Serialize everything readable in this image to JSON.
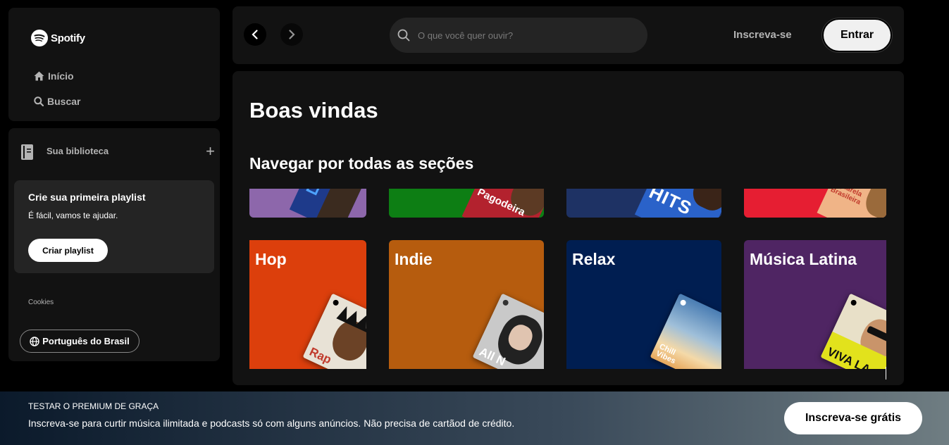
{
  "brand": {
    "name": "Spotify"
  },
  "nav": {
    "home_label": "Início",
    "search_label": "Buscar"
  },
  "library": {
    "title": "Sua biblioteca",
    "promo": {
      "title": "Crie sua primeira playlist",
      "subtitle": "É fácil, vamos te ajudar.",
      "button": "Criar playlist"
    },
    "cookies": "Cookies",
    "language": "Português do Brasil"
  },
  "topbar": {
    "search_placeholder": "O que você quer ouvir?",
    "signup": "Inscreva-se",
    "login": "Entrar"
  },
  "main": {
    "title": "Boas vindas",
    "section_title": "Navegar por todas as seções",
    "top_row": [
      {
        "color": "#8d67ab",
        "art_text": ""
      },
      {
        "color": "#0d7e14",
        "art_text": "Pagodeira"
      },
      {
        "color": "#1e3264",
        "art_text": "HITS"
      },
      {
        "color": "#e61e32",
        "art_text": "Aquarela Brasileira"
      }
    ],
    "categories": [
      {
        "label": "Hop",
        "color": "#dc3f0c",
        "art_text": "Rap",
        "icon": "album-cover-icon"
      },
      {
        "label": "Indie",
        "color": "#b65c0e",
        "art_text": "All N",
        "icon": "album-cover-icon"
      },
      {
        "label": "Relax",
        "color": "#001e51",
        "art_text": "Chill Vibes",
        "icon": "album-cover-icon"
      },
      {
        "label": "Música Latina",
        "color": "#4f2563",
        "art_text": "VIVA LA",
        "icon": "album-cover-icon"
      }
    ]
  },
  "banner": {
    "kicker": "TESTAR O PREMIUM DE GRAÇA",
    "text": "Inscreva-se para curtir música ilimitada e podcasts só com alguns anúncios. Não precisa de cartãod de crédito.",
    "button": "Inscreva-se grátis"
  }
}
